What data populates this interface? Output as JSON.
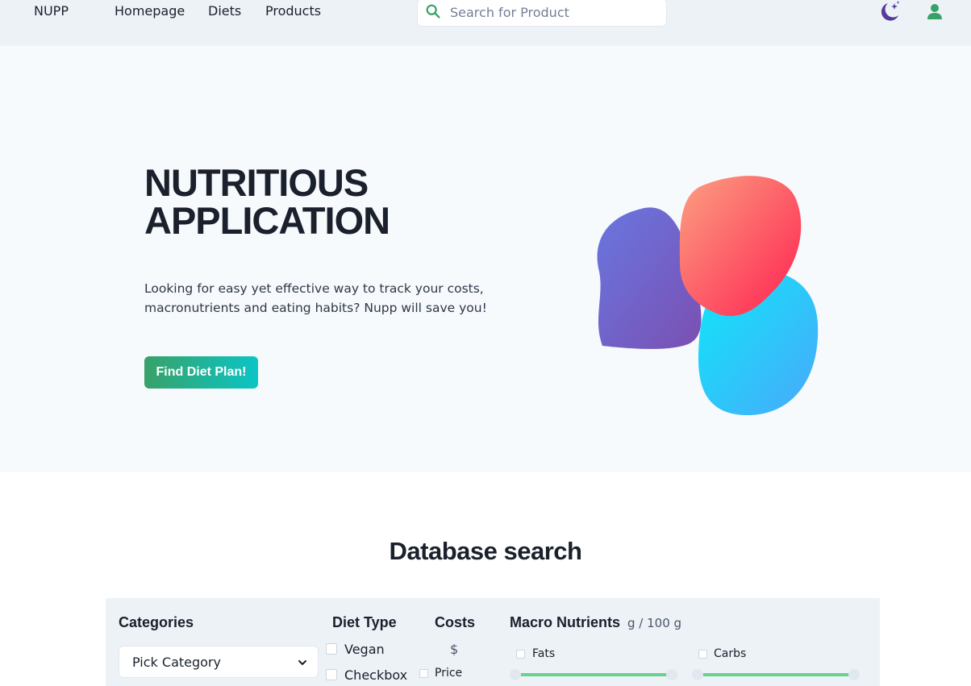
{
  "header": {
    "brand": "NUPP",
    "nav": [
      "Homepage",
      "Diets",
      "Products"
    ],
    "search_placeholder": "Search for Product",
    "icons": [
      "search-icon",
      "moon-icon",
      "user-icon"
    ],
    "colors": {
      "bar": "#edf2f7",
      "accent": "#38a169",
      "moon": "#553c9a"
    }
  },
  "hero": {
    "title_lines": [
      "NUTRITIOUS",
      "APPLICATION"
    ],
    "description_lines": [
      "Looking for easy yet effective way to track your costs,",
      "macronutrients and eating habits? Nupp will save you!"
    ],
    "cta_label": "Find Diet Plan!"
  },
  "database_search": {
    "title": "Database search",
    "categories": {
      "title": "Categories",
      "selected": "Pick Category"
    },
    "diet_type": {
      "title": "Diet Type",
      "options": [
        "Vegan",
        "Checkbox"
      ]
    },
    "costs": {
      "title": "Costs",
      "currency": "$",
      "option": "Price"
    },
    "macro": {
      "title": "Macro Nutrients",
      "unit": "g / 100 g",
      "items": [
        {
          "label": "Fats",
          "range": [
            0,
            1
          ]
        },
        {
          "label": "Carbs",
          "range": [
            0,
            1
          ]
        }
      ]
    }
  }
}
